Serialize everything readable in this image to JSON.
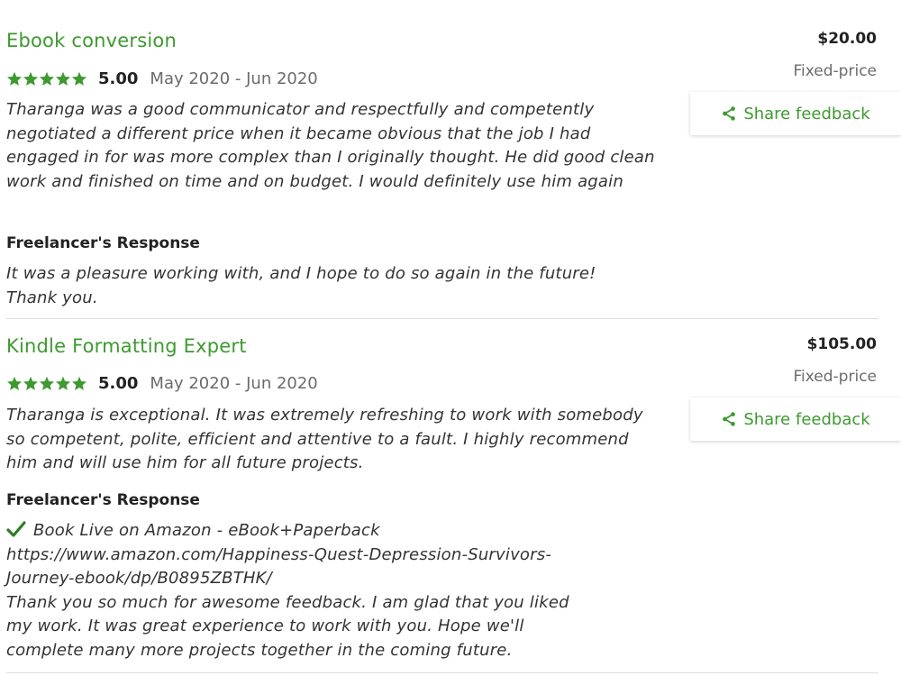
{
  "colors": {
    "accent_green": "#3d9a2f",
    "text": "#222222",
    "muted": "#6b6b6b"
  },
  "jobs": [
    {
      "title": "Ebook conversion",
      "rating": "5.00",
      "stars": 5,
      "dates": "May 2020 - Jun 2020",
      "feedback": "Tharanga was a good communicator and respectfully and competently negotiated a different price when it became obvious that the job I had engaged in for was more complex than I originally thought. He did good clean work and finished on time and on budget. I would definitely use him again",
      "response_heading": "Freelancer's Response",
      "response_lines": [
        "It was a pleasure working with, and I hope to do so again in the future!",
        "Thank you."
      ],
      "amount": "$20.00",
      "price_type": "Fixed-price",
      "share_label": "Share feedback"
    },
    {
      "title": "Kindle Formatting Expert",
      "rating": "5.00",
      "stars": 5,
      "dates": "May 2020 - Jun 2020",
      "feedback": "Tharanga is exceptional. It was extremely refreshing to work with somebody so competent, polite, efficient and attentive to a fault. I highly recommend him and will use him for all future projects.",
      "response_heading": "Freelancer's Response",
      "response_lines": [
        "Book Live on Amazon - eBook+Paperback",
        "https://www.amazon.com/Happiness-Quest-Depression-Survivors-",
        "Journey-ebook/dp/B0895ZBTHK/",
        "Thank you so much for awesome feedback. I am glad that you liked",
        "my work. It was great experience to work with you. Hope we'll",
        "complete many more projects together in the coming future."
      ],
      "amount": "$105.00",
      "price_type": "Fixed-price",
      "share_label": "Share feedback"
    }
  ],
  "icons": {
    "star": "star-icon",
    "share": "share-icon",
    "check": "checkmark-icon"
  }
}
